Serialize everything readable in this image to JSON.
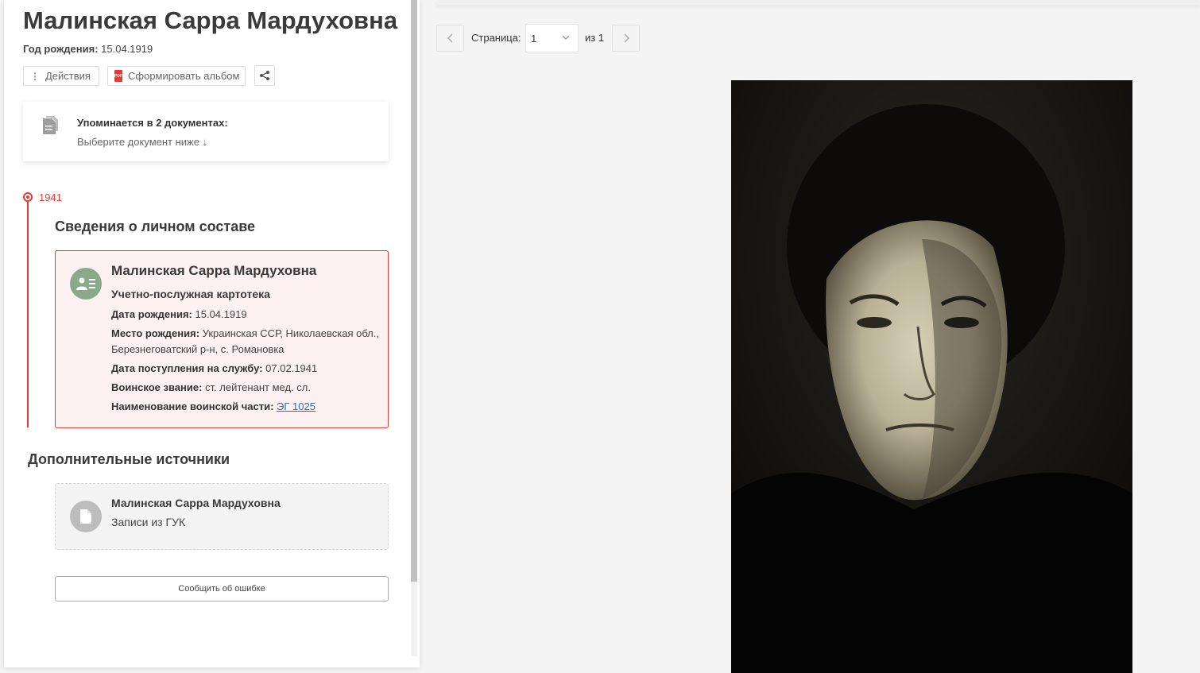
{
  "person": {
    "name": "Малинская Сарра Мардуховна",
    "birth_label": "Год рождения:",
    "birth_value": "15.04.1919"
  },
  "actions": {
    "actions_label": "Действия",
    "album_label": "Сформировать альбом",
    "pdf_badge": "PDF"
  },
  "mentions": {
    "title": "Упоминается в 2 документах:",
    "subtitle": "Выберите документ ниже ↓"
  },
  "timeline": {
    "year": "1941",
    "section_title": "Сведения о личном составе"
  },
  "record": {
    "name": "Малинская Сарра Мардуховна",
    "type": "Учетно-послужная картотека",
    "fields": [
      {
        "label": "Дата рождения:",
        "value": "15.04.1919"
      },
      {
        "label": "Место рождения:",
        "value": "Украинская ССР, Николаевская обл., Березнеговатский р-н, с. Романовка"
      },
      {
        "label": "Дата поступления на службу:",
        "value": "07.02.1941"
      },
      {
        "label": "Воинское звание:",
        "value": "ст. лейтенант мед. сл."
      },
      {
        "label": "Наименование воинской части:",
        "value": "ЭГ 1025"
      }
    ]
  },
  "additional": {
    "title": "Дополнительные источники",
    "name": "Малинская Сарра Мардуховна",
    "subtitle": "Записи из ГУК"
  },
  "report_button": "Сообщить об ошибке",
  "pager": {
    "label": "Страница:",
    "current": "1",
    "of_text": "из 1"
  },
  "colors": {
    "accent": "#e53935",
    "link": "#1a73c8",
    "record_bg": "#fdf2f1",
    "icon_green": "#8aa88a"
  }
}
